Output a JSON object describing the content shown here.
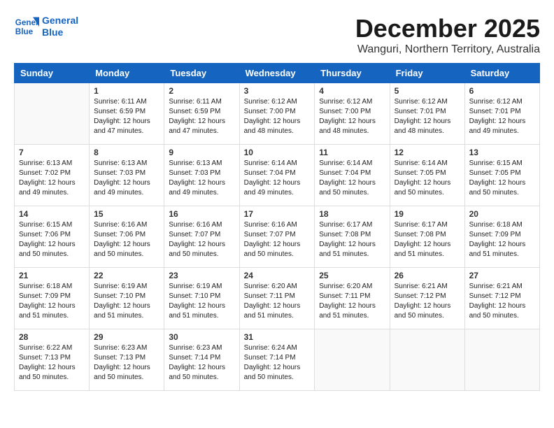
{
  "logo": {
    "line1": "General",
    "line2": "Blue"
  },
  "title": "December 2025",
  "location": "Wanguri, Northern Territory, Australia",
  "days_of_week": [
    "Sunday",
    "Monday",
    "Tuesday",
    "Wednesday",
    "Thursday",
    "Friday",
    "Saturday"
  ],
  "weeks": [
    [
      {
        "day": "",
        "info": ""
      },
      {
        "day": "1",
        "info": "Sunrise: 6:11 AM\nSunset: 6:59 PM\nDaylight: 12 hours\nand 47 minutes."
      },
      {
        "day": "2",
        "info": "Sunrise: 6:11 AM\nSunset: 6:59 PM\nDaylight: 12 hours\nand 47 minutes."
      },
      {
        "day": "3",
        "info": "Sunrise: 6:12 AM\nSunset: 7:00 PM\nDaylight: 12 hours\nand 48 minutes."
      },
      {
        "day": "4",
        "info": "Sunrise: 6:12 AM\nSunset: 7:00 PM\nDaylight: 12 hours\nand 48 minutes."
      },
      {
        "day": "5",
        "info": "Sunrise: 6:12 AM\nSunset: 7:01 PM\nDaylight: 12 hours\nand 48 minutes."
      },
      {
        "day": "6",
        "info": "Sunrise: 6:12 AM\nSunset: 7:01 PM\nDaylight: 12 hours\nand 49 minutes."
      }
    ],
    [
      {
        "day": "7",
        "info": "Sunrise: 6:13 AM\nSunset: 7:02 PM\nDaylight: 12 hours\nand 49 minutes."
      },
      {
        "day": "8",
        "info": "Sunrise: 6:13 AM\nSunset: 7:03 PM\nDaylight: 12 hours\nand 49 minutes."
      },
      {
        "day": "9",
        "info": "Sunrise: 6:13 AM\nSunset: 7:03 PM\nDaylight: 12 hours\nand 49 minutes."
      },
      {
        "day": "10",
        "info": "Sunrise: 6:14 AM\nSunset: 7:04 PM\nDaylight: 12 hours\nand 49 minutes."
      },
      {
        "day": "11",
        "info": "Sunrise: 6:14 AM\nSunset: 7:04 PM\nDaylight: 12 hours\nand 50 minutes."
      },
      {
        "day": "12",
        "info": "Sunrise: 6:14 AM\nSunset: 7:05 PM\nDaylight: 12 hours\nand 50 minutes."
      },
      {
        "day": "13",
        "info": "Sunrise: 6:15 AM\nSunset: 7:05 PM\nDaylight: 12 hours\nand 50 minutes."
      }
    ],
    [
      {
        "day": "14",
        "info": "Sunrise: 6:15 AM\nSunset: 7:06 PM\nDaylight: 12 hours\nand 50 minutes."
      },
      {
        "day": "15",
        "info": "Sunrise: 6:16 AM\nSunset: 7:06 PM\nDaylight: 12 hours\nand 50 minutes."
      },
      {
        "day": "16",
        "info": "Sunrise: 6:16 AM\nSunset: 7:07 PM\nDaylight: 12 hours\nand 50 minutes."
      },
      {
        "day": "17",
        "info": "Sunrise: 6:16 AM\nSunset: 7:07 PM\nDaylight: 12 hours\nand 50 minutes."
      },
      {
        "day": "18",
        "info": "Sunrise: 6:17 AM\nSunset: 7:08 PM\nDaylight: 12 hours\nand 51 minutes."
      },
      {
        "day": "19",
        "info": "Sunrise: 6:17 AM\nSunset: 7:08 PM\nDaylight: 12 hours\nand 51 minutes."
      },
      {
        "day": "20",
        "info": "Sunrise: 6:18 AM\nSunset: 7:09 PM\nDaylight: 12 hours\nand 51 minutes."
      }
    ],
    [
      {
        "day": "21",
        "info": "Sunrise: 6:18 AM\nSunset: 7:09 PM\nDaylight: 12 hours\nand 51 minutes."
      },
      {
        "day": "22",
        "info": "Sunrise: 6:19 AM\nSunset: 7:10 PM\nDaylight: 12 hours\nand 51 minutes."
      },
      {
        "day": "23",
        "info": "Sunrise: 6:19 AM\nSunset: 7:10 PM\nDaylight: 12 hours\nand 51 minutes."
      },
      {
        "day": "24",
        "info": "Sunrise: 6:20 AM\nSunset: 7:11 PM\nDaylight: 12 hours\nand 51 minutes."
      },
      {
        "day": "25",
        "info": "Sunrise: 6:20 AM\nSunset: 7:11 PM\nDaylight: 12 hours\nand 51 minutes."
      },
      {
        "day": "26",
        "info": "Sunrise: 6:21 AM\nSunset: 7:12 PM\nDaylight: 12 hours\nand 50 minutes."
      },
      {
        "day": "27",
        "info": "Sunrise: 6:21 AM\nSunset: 7:12 PM\nDaylight: 12 hours\nand 50 minutes."
      }
    ],
    [
      {
        "day": "28",
        "info": "Sunrise: 6:22 AM\nSunset: 7:13 PM\nDaylight: 12 hours\nand 50 minutes."
      },
      {
        "day": "29",
        "info": "Sunrise: 6:23 AM\nSunset: 7:13 PM\nDaylight: 12 hours\nand 50 minutes."
      },
      {
        "day": "30",
        "info": "Sunrise: 6:23 AM\nSunset: 7:14 PM\nDaylight: 12 hours\nand 50 minutes."
      },
      {
        "day": "31",
        "info": "Sunrise: 6:24 AM\nSunset: 7:14 PM\nDaylight: 12 hours\nand 50 minutes."
      },
      {
        "day": "",
        "info": ""
      },
      {
        "day": "",
        "info": ""
      },
      {
        "day": "",
        "info": ""
      }
    ]
  ]
}
